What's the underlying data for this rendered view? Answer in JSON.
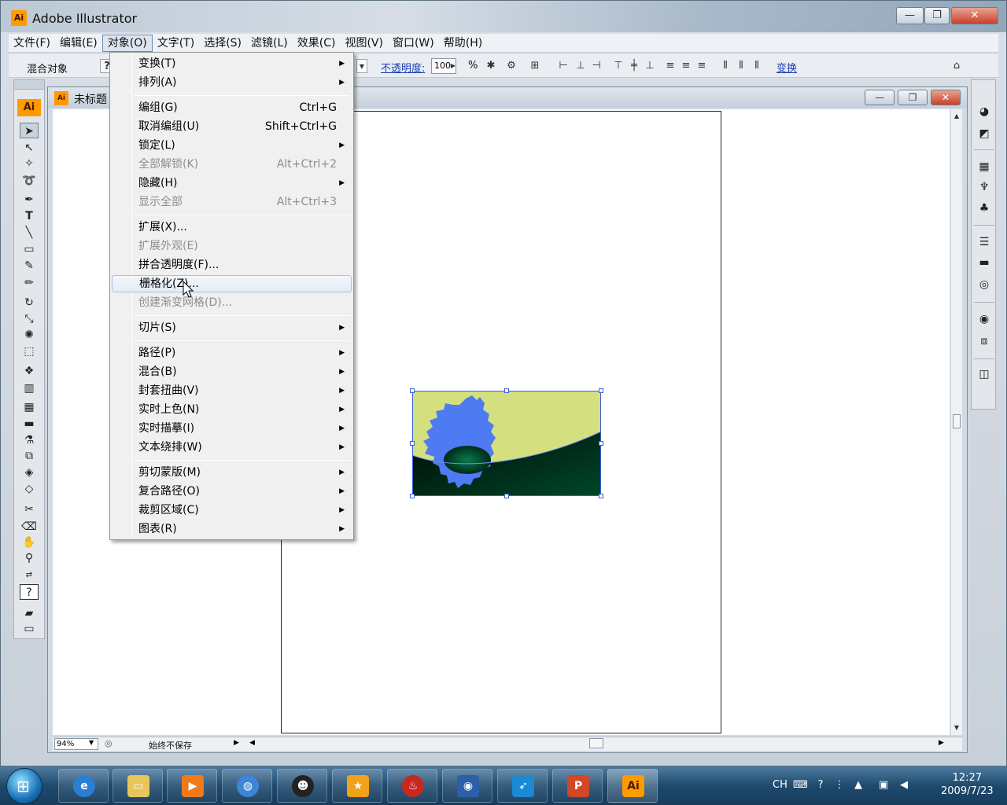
{
  "app": {
    "title": "Adobe Illustrator",
    "logo": "Ai"
  },
  "window_buttons": {
    "minimize": "—",
    "maximize": "❐",
    "close": "✕"
  },
  "menubar": {
    "items": [
      "文件(F)",
      "编辑(E)",
      "对象(O)",
      "文字(T)",
      "选择(S)",
      "滤镜(L)",
      "效果(C)",
      "视图(V)",
      "窗口(W)",
      "帮助(H)"
    ],
    "active": "对象(O)"
  },
  "controlbar": {
    "selection_label": "混合对象",
    "opacity_label": "不透明度:",
    "opacity_value": "100",
    "opacity_unit": "%",
    "transform_link": "变换"
  },
  "toolbox": {
    "badge": "Ai"
  },
  "document": {
    "title": "未标题",
    "zoom": "94%",
    "status": "始终不保存"
  },
  "object_menu": {
    "items": [
      {
        "label": "变换(T)",
        "shortcut": "",
        "submenu": true,
        "disabled": false
      },
      {
        "label": "排列(A)",
        "shortcut": "",
        "submenu": true,
        "disabled": false
      },
      {
        "label": "编组(G)",
        "shortcut": "Ctrl+G",
        "submenu": false,
        "disabled": false
      },
      {
        "label": "取消编组(U)",
        "shortcut": "Shift+Ctrl+G",
        "submenu": false,
        "disabled": false
      },
      {
        "label": "锁定(L)",
        "shortcut": "",
        "submenu": true,
        "disabled": false
      },
      {
        "label": "全部解锁(K)",
        "shortcut": "Alt+Ctrl+2",
        "submenu": false,
        "disabled": true
      },
      {
        "label": "隐藏(H)",
        "shortcut": "",
        "submenu": true,
        "disabled": false
      },
      {
        "label": "显示全部",
        "shortcut": "Alt+Ctrl+3",
        "submenu": false,
        "disabled": true
      },
      {
        "label": "扩展(X)...",
        "shortcut": "",
        "submenu": false,
        "disabled": false
      },
      {
        "label": "扩展外观(E)",
        "shortcut": "",
        "submenu": false,
        "disabled": true
      },
      {
        "label": "拼合透明度(F)...",
        "shortcut": "",
        "submenu": false,
        "disabled": false
      },
      {
        "label": "栅格化(Z)...",
        "shortcut": "",
        "submenu": false,
        "disabled": false,
        "hover": true
      },
      {
        "label": "创建渐变网格(D)...",
        "shortcut": "",
        "submenu": false,
        "disabled": true
      },
      {
        "label": "切片(S)",
        "shortcut": "",
        "submenu": true,
        "disabled": false
      },
      {
        "label": "路径(P)",
        "shortcut": "",
        "submenu": true,
        "disabled": false
      },
      {
        "label": "混合(B)",
        "shortcut": "",
        "submenu": true,
        "disabled": false
      },
      {
        "label": "封套扭曲(V)",
        "shortcut": "",
        "submenu": true,
        "disabled": false
      },
      {
        "label": "实时上色(N)",
        "shortcut": "",
        "submenu": true,
        "disabled": false
      },
      {
        "label": "实时描摹(I)",
        "shortcut": "",
        "submenu": true,
        "disabled": false
      },
      {
        "label": "文本绕排(W)",
        "shortcut": "",
        "submenu": true,
        "disabled": false
      },
      {
        "label": "剪切蒙版(M)",
        "shortcut": "",
        "submenu": true,
        "disabled": false
      },
      {
        "label": "复合路径(O)",
        "shortcut": "",
        "submenu": true,
        "disabled": false
      },
      {
        "label": "裁剪区域(C)",
        "shortcut": "",
        "submenu": true,
        "disabled": false
      },
      {
        "label": "图表(R)",
        "shortcut": "",
        "submenu": true,
        "disabled": false
      }
    ],
    "submenu_arrow": "▶"
  },
  "taskbar": {
    "language": "CH",
    "time": "12:27",
    "date": "2009/7/23",
    "ai_button": "Ai"
  },
  "colors": {
    "ai_orange": "#ff9a00",
    "selection_blue": "#3b5fd6",
    "art_yellow": "#d4e07f",
    "art_dark_green": "#00331c",
    "tree_blue": "#4f7bf2"
  }
}
